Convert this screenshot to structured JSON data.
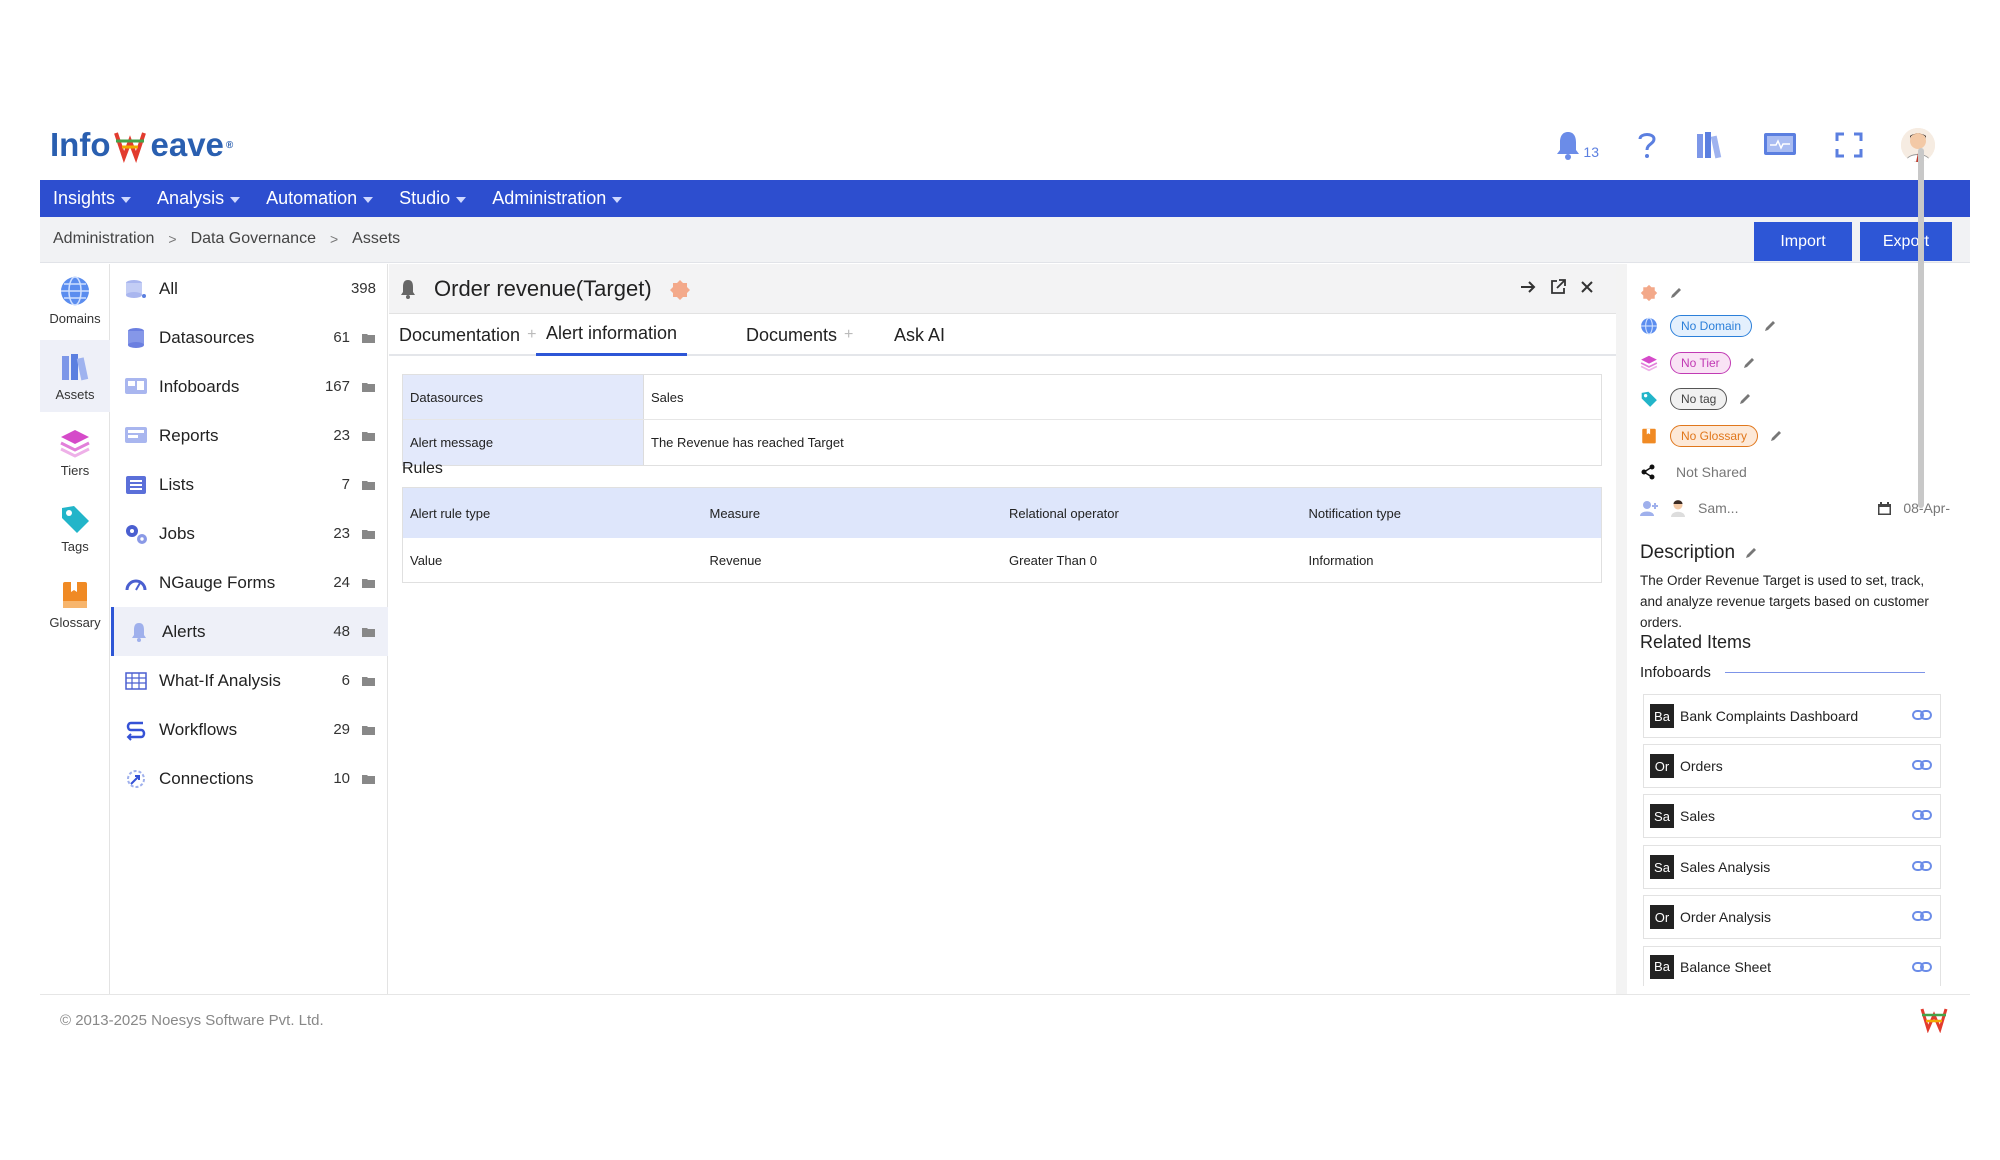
{
  "app": {
    "logo_text_left": "Info",
    "logo_text_right": "eave"
  },
  "header": {
    "notification_count": "13"
  },
  "nav": [
    {
      "label": "Insights"
    },
    {
      "label": "Analysis"
    },
    {
      "label": "Automation"
    },
    {
      "label": "Studio"
    },
    {
      "label": "Administration"
    }
  ],
  "breadcrumb": [
    "Administration",
    "Data Governance",
    "Assets"
  ],
  "actions": {
    "import_label": "Import",
    "export_label": "Export"
  },
  "rail": [
    {
      "label": "Domains",
      "icon": "globe-icon"
    },
    {
      "label": "Assets",
      "icon": "books-icon"
    },
    {
      "label": "Tiers",
      "icon": "layers-icon"
    },
    {
      "label": "Tags",
      "icon": "tag-icon"
    },
    {
      "label": "Glossary",
      "icon": "book-icon"
    }
  ],
  "assets": [
    {
      "label": "All",
      "count": "398"
    },
    {
      "label": "Datasources",
      "count": "61"
    },
    {
      "label": "Infoboards",
      "count": "167"
    },
    {
      "label": "Reports",
      "count": "23"
    },
    {
      "label": "Lists",
      "count": "7"
    },
    {
      "label": "Jobs",
      "count": "23"
    },
    {
      "label": "NGauge Forms",
      "count": "24"
    },
    {
      "label": "Alerts",
      "count": "48"
    },
    {
      "label": "What-If Analysis",
      "count": "6"
    },
    {
      "label": "Workflows",
      "count": "29"
    },
    {
      "label": "Connections",
      "count": "10"
    }
  ],
  "panel": {
    "title": "Order revenue(Target)",
    "tabs": [
      {
        "label": "Documentation"
      },
      {
        "label": "Alert information"
      },
      {
        "label": "Documents"
      },
      {
        "label": "Ask AI"
      }
    ],
    "info": [
      {
        "key": "Datasources",
        "value": "Sales"
      },
      {
        "key": "Alert message",
        "value": "The Revenue has reached Target"
      }
    ],
    "rules_title": "Rules",
    "rules_headers": [
      "Alert rule type",
      "Measure",
      "Relational operator",
      "Notification type"
    ],
    "rules_rows": [
      [
        "Value",
        "Revenue",
        "Greater Than 0",
        "Information"
      ]
    ]
  },
  "side": {
    "domain": "No Domain",
    "tier": "No Tier",
    "tag": "No tag",
    "glossary": "No Glossary",
    "shared": "Not Shared",
    "owner": "Sam...",
    "date": "08-Apr-",
    "description_title": "Description",
    "description": "The Order Revenue Target is used to set, track, and analyze revenue targets based on customer orders.",
    "related_title": "Related Items",
    "related_group": "Infoboards",
    "related_items": [
      {
        "abbr": "Ba",
        "name": "Bank Complaints Dashboard"
      },
      {
        "abbr": "Or",
        "name": "Orders"
      },
      {
        "abbr": "Sa",
        "name": "Sales"
      },
      {
        "abbr": "Sa",
        "name": "Sales Analysis"
      },
      {
        "abbr": "Or",
        "name": "Order Analysis"
      },
      {
        "abbr": "Ba",
        "name": "Balance Sheet"
      }
    ]
  },
  "footer": {
    "copyright": "© 2013-2025 Noesys Software Pvt. Ltd."
  },
  "colors": {
    "brand": "#2d4ecf",
    "accent": "#2d56d6",
    "selected_bg": "#eef0f8"
  }
}
